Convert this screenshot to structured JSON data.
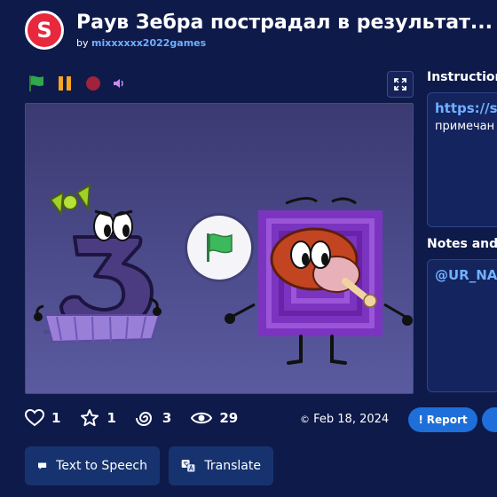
{
  "app": {
    "logo_letter": "S",
    "title": "Раув Зебра пострадал в результат...",
    "by_label": "by",
    "author": "mixxxxxx2022games"
  },
  "controls": {
    "icons": [
      "green-flag-icon",
      "pause-icon",
      "stop-icon",
      "sound-icon"
    ],
    "colors": {
      "flag": "#2ea84a",
      "pause": "#f5a623",
      "stop": "#a0233b",
      "sound": "#c58cf0"
    }
  },
  "side": {
    "instructions_heading": "Instructions",
    "instructions_link": "https://sc",
    "instructions_text": "примечан",
    "notes_heading": "Notes and",
    "notes_text": "@UR_NA"
  },
  "stats": {
    "likes": "1",
    "favorites": "1",
    "remixes": "3",
    "views": "29",
    "date": "Feb 18, 2024"
  },
  "buttons": {
    "report": "Report",
    "text_to_speech": "Text to Speech",
    "translate": "Translate"
  },
  "colors": {
    "background": "#0e1a4a",
    "accent": "#1e6fd9",
    "link": "#6fb0ff",
    "brand": "#e8283c"
  }
}
